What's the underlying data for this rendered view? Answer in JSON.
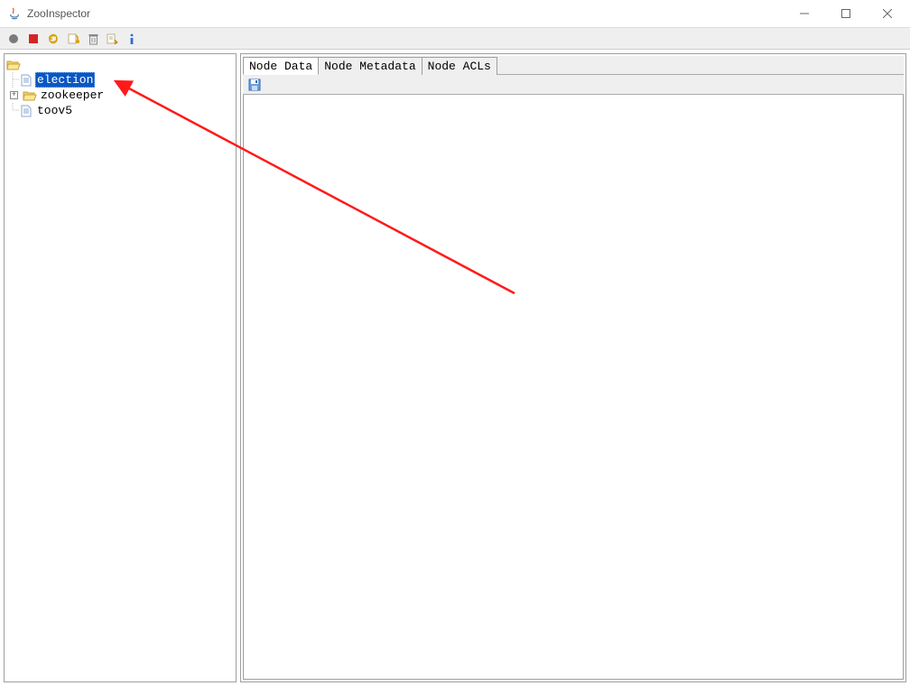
{
  "window": {
    "title": "ZooInspector"
  },
  "toolbar": {
    "connect": "connect",
    "disconnect": "disconnect",
    "refresh": "refresh",
    "add": "add-node",
    "delete": "delete-node",
    "viewers": "node-viewers",
    "about": "about"
  },
  "tree": {
    "root": "/",
    "items": [
      {
        "label": "election",
        "type": "leaf",
        "selected": true,
        "expandable": false
      },
      {
        "label": "zookeeper",
        "type": "folder",
        "selected": false,
        "expandable": true
      },
      {
        "label": "toov5",
        "type": "leaf",
        "selected": false,
        "expandable": false
      }
    ]
  },
  "tabs": {
    "items": [
      {
        "label": "Node Data",
        "active": true
      },
      {
        "label": "Node Metadata",
        "active": false
      },
      {
        "label": "Node ACLs",
        "active": false
      }
    ]
  },
  "content": {
    "save": "save"
  }
}
